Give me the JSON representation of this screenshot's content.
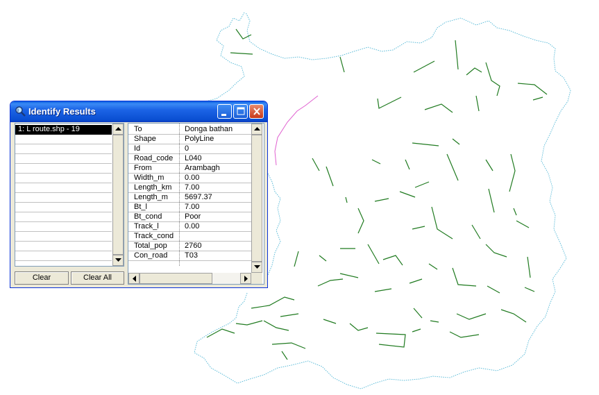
{
  "window": {
    "title": "Identify Results"
  },
  "results": {
    "items": [
      "1:  L route.shp - 19"
    ]
  },
  "attributes": [
    {
      "field": "To",
      "value": "Donga bathan"
    },
    {
      "field": "Shape",
      "value": "PolyLine"
    },
    {
      "field": "Id",
      "value": "0"
    },
    {
      "field": "Road_code",
      "value": "L040"
    },
    {
      "field": "From",
      "value": "Arambagh"
    },
    {
      "field": "Width_m",
      "value": "0.00"
    },
    {
      "field": "Length_km",
      "value": "7.00"
    },
    {
      "field": "Length_m",
      "value": "5697.37"
    },
    {
      "field": "Bt_l",
      "value": "7.00"
    },
    {
      "field": "Bt_cond",
      "value": "Poor"
    },
    {
      "field": "Track_l",
      "value": "0.00"
    },
    {
      "field": "Track_cond",
      "value": ""
    },
    {
      "field": "Total_pop",
      "value": "2760"
    },
    {
      "field": "Con_road",
      "value": "T03"
    }
  ],
  "buttons": {
    "clear": "Clear",
    "clear_all": "Clear All"
  },
  "colors": {
    "boundary": "#5bbbd8",
    "roads": "#1f7a1f",
    "selected_route": "#e060d0",
    "titlebar": "#1c5fd8"
  }
}
